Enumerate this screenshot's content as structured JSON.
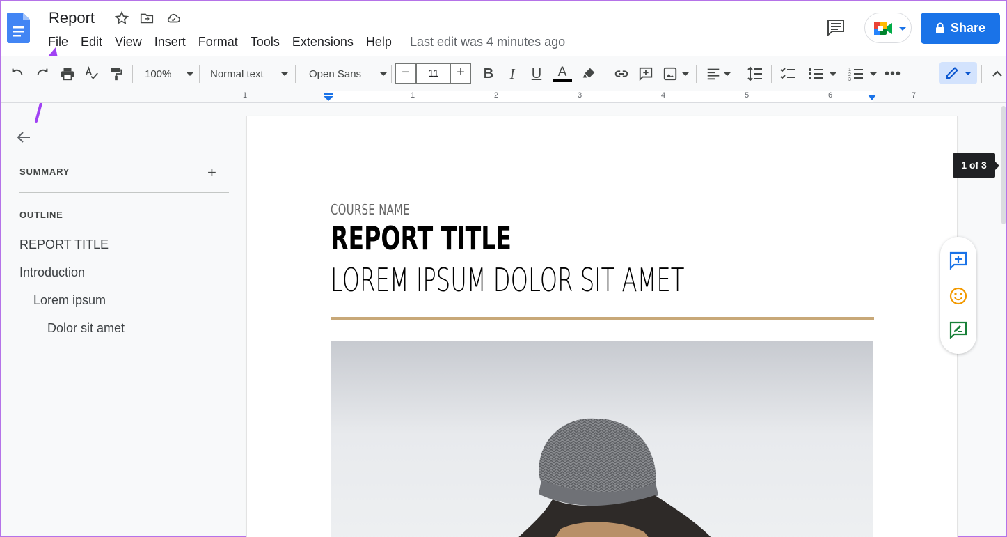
{
  "document": {
    "title": "Report",
    "last_edit": "Last edit was 4 minutes ago"
  },
  "menu": [
    "File",
    "Edit",
    "View",
    "Insert",
    "Format",
    "Tools",
    "Extensions",
    "Help"
  ],
  "header": {
    "share_label": "Share"
  },
  "toolbar": {
    "zoom": "100%",
    "style": "Normal text",
    "font": "Open Sans",
    "font_size": "11",
    "minus": "−",
    "plus": "+"
  },
  "ruler": {
    "numbers": [
      "1",
      "1",
      "2",
      "3",
      "4",
      "5",
      "6",
      "7"
    ]
  },
  "outline_panel": {
    "summary_label": "SUMMARY",
    "add_symbol": "+",
    "outline_label": "OUTLINE",
    "items": [
      {
        "text": "REPORT TITLE",
        "level": 1
      },
      {
        "text": "Introduction",
        "level": 1
      },
      {
        "text": "Lorem ipsum",
        "level": 2
      },
      {
        "text": "Dolor sit amet",
        "level": 3
      }
    ]
  },
  "page": {
    "course_name": "COURSE NAME",
    "report_title": "REPORT TITLE",
    "subtitle": "LOREM IPSUM DOLOR SIT AMET",
    "page_indicator": "1 of 3"
  },
  "colors": {
    "accent": "#1a73e8",
    "gold_rule": "#c8a878",
    "annotation_arrow": "#a142f4"
  },
  "icons": [
    "docs-logo-icon",
    "star-icon",
    "move-folder-icon",
    "cloud-status-icon",
    "comment-history-icon",
    "meet-icon",
    "lock-icon",
    "undo-icon",
    "redo-icon",
    "print-icon",
    "spellcheck-icon",
    "paint-format-icon",
    "bold-icon",
    "italic-icon",
    "underline-icon",
    "text-color-icon",
    "highlight-icon",
    "link-icon",
    "add-comment-icon",
    "insert-image-icon",
    "align-icon",
    "line-spacing-icon",
    "checklist-icon",
    "bulleted-list-icon",
    "numbered-list-icon",
    "more-icon",
    "pencil-icon",
    "collapse-icon",
    "back-arrow-icon",
    "add-comment-side-icon",
    "emoji-icon",
    "suggest-edit-icon"
  ]
}
